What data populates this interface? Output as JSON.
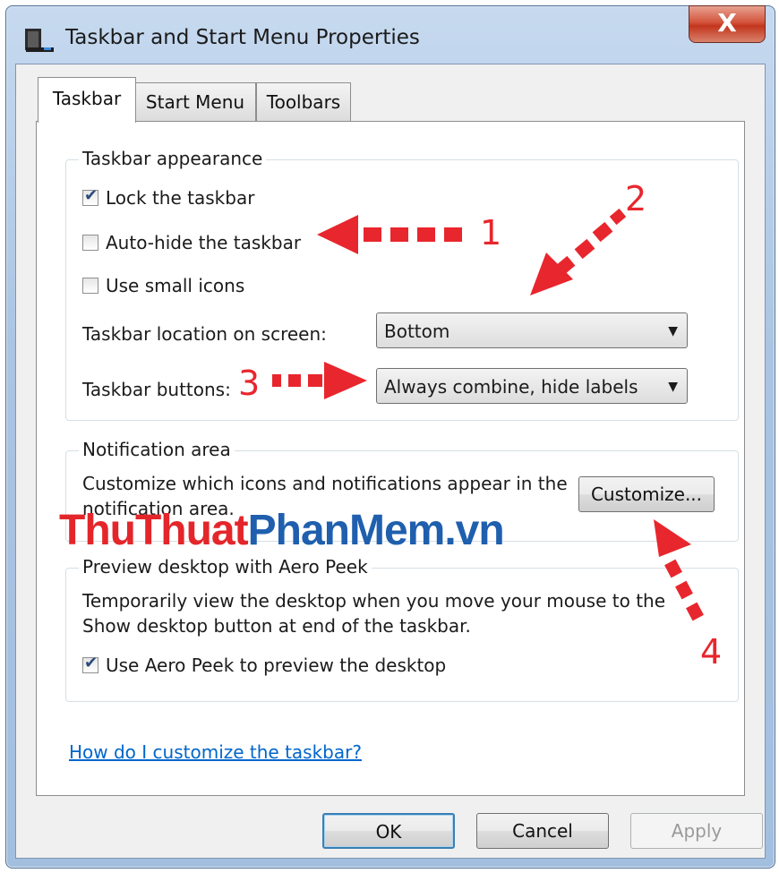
{
  "window": {
    "title": "Taskbar and Start Menu Properties",
    "close_label": "X"
  },
  "tabs": [
    {
      "label": "Taskbar",
      "active": true
    },
    {
      "label": "Start Menu",
      "active": false
    },
    {
      "label": "Toolbars",
      "active": false
    }
  ],
  "taskbar_appearance": {
    "title": "Taskbar appearance",
    "lock_taskbar": {
      "label": "Lock the taskbar",
      "checked": true
    },
    "auto_hide": {
      "label": "Auto-hide the taskbar",
      "checked": false
    },
    "small_icons": {
      "label": "Use small icons",
      "checked": false
    },
    "location_label": "Taskbar location on screen:",
    "location_value": "Bottom",
    "buttons_label": "Taskbar buttons:",
    "buttons_value": "Always combine, hide labels"
  },
  "notification_area": {
    "title": "Notification area",
    "description_line1": "Customize which icons and notifications appear in the",
    "description_line2": "notification area.",
    "customize_button": "Customize..."
  },
  "aero_peek": {
    "title": "Preview desktop with Aero Peek",
    "description_line1": "Temporarily view the desktop when you move your mouse to the",
    "description_line2": "Show desktop button at end of the taskbar.",
    "use_aero_peek": {
      "label": "Use Aero Peek to preview the desktop",
      "checked": true
    }
  },
  "help_link": "How do I customize the taskbar?",
  "buttons": {
    "ok": "OK",
    "cancel": "Cancel",
    "apply": "Apply"
  },
  "annotations": {
    "a1": "1",
    "a2": "2",
    "a3": "3",
    "a4": "4"
  },
  "watermark": {
    "part1": "ThuThuat",
    "part2": "PhanMem",
    "part3": ".vn"
  },
  "colors": {
    "annotation": "#e8262d",
    "watermark_red": "#e4262b",
    "watermark_blue": "#1f5fae",
    "link": "#0066cc"
  }
}
